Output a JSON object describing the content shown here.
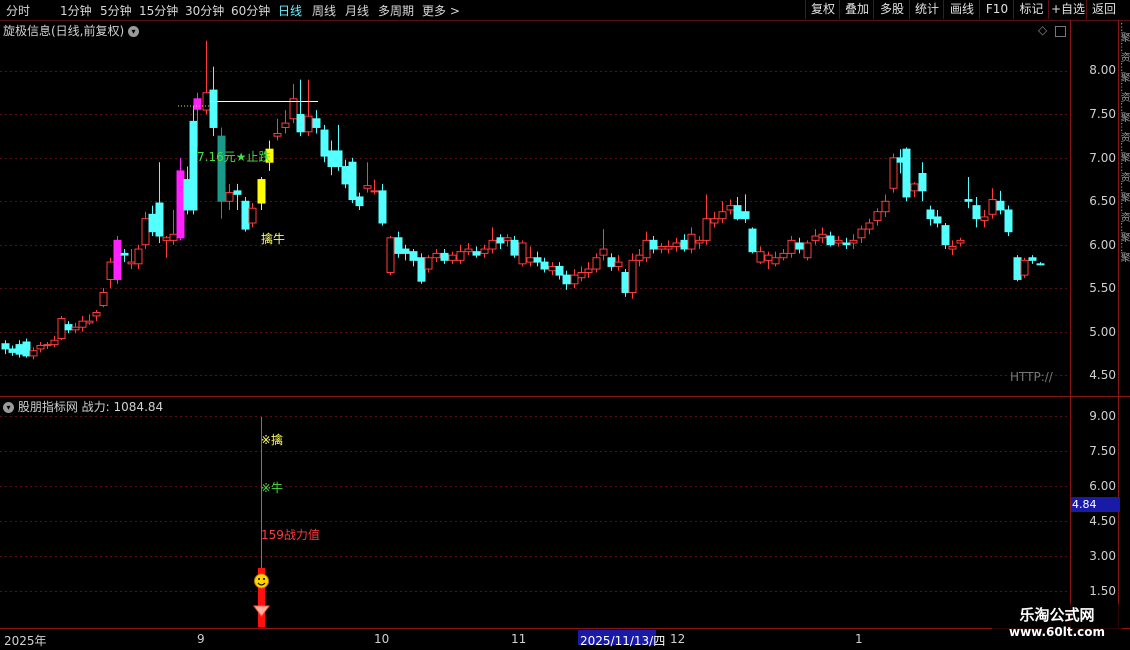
{
  "toolbar": {
    "periods": [
      "分时",
      "1分钟",
      "5分钟",
      "15分钟",
      "30分钟",
      "60分钟",
      "日线",
      "周线",
      "月线",
      "多周期",
      "更多 >"
    ],
    "active_period": "日线",
    "actions": [
      "复权",
      "叠加",
      "多股",
      "统计",
      "画线",
      "F10",
      "标记",
      "+自选",
      "返回"
    ]
  },
  "main_chart": {
    "title": "旋极信息(日线,前复权)",
    "y_ticks": [
      "8.00",
      "7.50",
      "7.00",
      "6.50",
      "6.00",
      "5.50",
      "5.00",
      "4.50"
    ],
    "annotation_price": "7.16元★止跌",
    "annotation_signal": "擒牛",
    "watermark": "HTTP://"
  },
  "indicator": {
    "title": "股朋指标网",
    "value_label": "战力: 1084.84",
    "y_ticks": [
      "9.00",
      "7.50",
      "6.00",
      "4.50",
      "3.00",
      "1.50"
    ],
    "current_value": "4.84",
    "label_qin": "※擒",
    "label_niu": "※牛",
    "label_power": "159战力值"
  },
  "x_axis": {
    "labels": [
      "2025年",
      "9",
      "10",
      "11",
      "2025/11/13/四",
      "12",
      "1"
    ]
  },
  "logo": {
    "name": "乐淘公式网",
    "url": "www.60lt.com"
  },
  "right_strip_text": "…聚…资…聚…资…聚…资…聚…资…聚…资…聚…聚",
  "colors": {
    "up": "#ff3b3b",
    "down": "#54ffff",
    "grid": "#5a1010",
    "yellow": "#ffff00",
    "magenta": "#ff22ff",
    "teal": "#1a9a8a"
  }
}
